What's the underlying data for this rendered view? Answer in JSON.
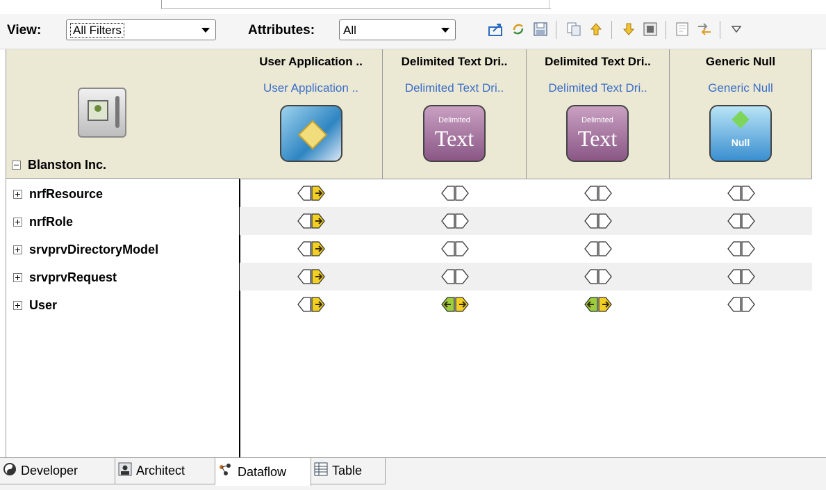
{
  "toolbar": {
    "view_label": "View:",
    "view_value": "All Filters",
    "attributes_label": "Attributes:",
    "attributes_value": "All",
    "buttons": [
      "export-icon",
      "refresh-icon",
      "save-icon",
      "copy-icon",
      "move-up-icon",
      "move-down-icon",
      "properties-icon",
      "new-doc-icon",
      "flow-icon",
      "dropdown-menu-icon"
    ]
  },
  "tree": {
    "root_label": "Blanston Inc.",
    "items": [
      "nrfResource",
      "nrfRole",
      "srvprvDirectoryModel",
      "srvprvRequest",
      "User"
    ]
  },
  "columns": [
    {
      "title": "User Application ..",
      "subtitle": "User Application ..",
      "icon": "user-application-driver-icon"
    },
    {
      "title": "Delimited Text Dri..",
      "subtitle": "Delimited Text Dri..",
      "icon": "delimited-text-driver-icon",
      "icon_small_text": "Delimited",
      "icon_big_text": "Text"
    },
    {
      "title": "Delimited Text Dri..",
      "subtitle": "Delimited Text Dri..",
      "icon": "delimited-text-driver-icon",
      "icon_small_text": "Delimited",
      "icon_big_text": "Text"
    },
    {
      "title": "Generic Null",
      "subtitle": "Generic Null",
      "icon": "generic-null-driver-icon",
      "icon_big_text": "Null"
    }
  ],
  "flows_note": "each cell = [subscriber-arrow-active, publisher-arrow-active]",
  "flows": [
    [
      [
        false,
        true
      ],
      [
        false,
        false
      ],
      [
        false,
        false
      ],
      [
        false,
        false
      ]
    ],
    [
      [
        false,
        true
      ],
      [
        false,
        false
      ],
      [
        false,
        false
      ],
      [
        false,
        false
      ]
    ],
    [
      [
        false,
        true
      ],
      [
        false,
        false
      ],
      [
        false,
        false
      ],
      [
        false,
        false
      ]
    ],
    [
      [
        false,
        true
      ],
      [
        false,
        false
      ],
      [
        false,
        false
      ],
      [
        false,
        false
      ]
    ],
    [
      [
        false,
        true
      ],
      [
        true,
        true
      ],
      [
        true,
        true
      ],
      [
        false,
        false
      ]
    ]
  ],
  "colors": {
    "header_bg": "#ebe8d4",
    "link_blue": "#3a6ec8",
    "arrow_yellow": "#f2d023",
    "arrow_green": "#9ccd3c"
  },
  "bottom_tabs": [
    {
      "label": "Developer",
      "icon": "developer-icon",
      "active": false
    },
    {
      "label": "Architect",
      "icon": "architect-icon",
      "active": false
    },
    {
      "label": "Dataflow",
      "icon": "dataflow-icon",
      "active": true
    },
    {
      "label": "Table",
      "icon": "table-icon",
      "active": false
    }
  ]
}
